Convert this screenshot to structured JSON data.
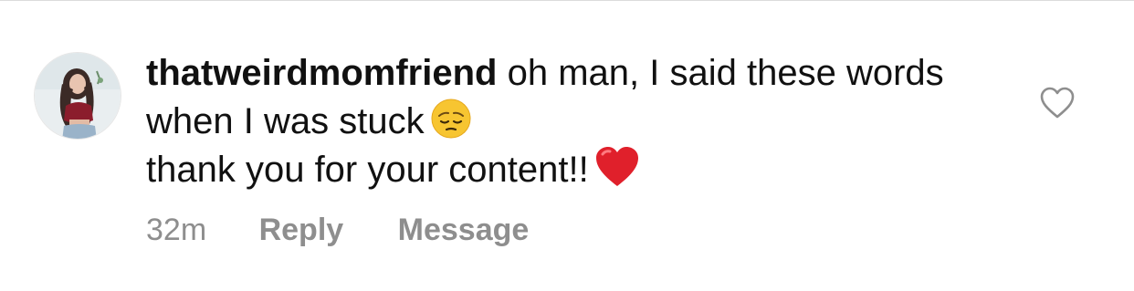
{
  "comment": {
    "username": "thatweirdmomfriend",
    "text_part1": "oh man, I said these words when I was stuck",
    "emoji_1": "pensive-face-emoji",
    "text_part2": "thank you for your content!!",
    "emoji_2": "red-heart-emoji",
    "timestamp": "32m",
    "reply_label": "Reply",
    "message_label": "Message",
    "like_icon": "heart-outline-icon"
  },
  "colors": {
    "text": "#111111",
    "meta": "#8e8e8e",
    "heart_red": "#e0202b"
  }
}
